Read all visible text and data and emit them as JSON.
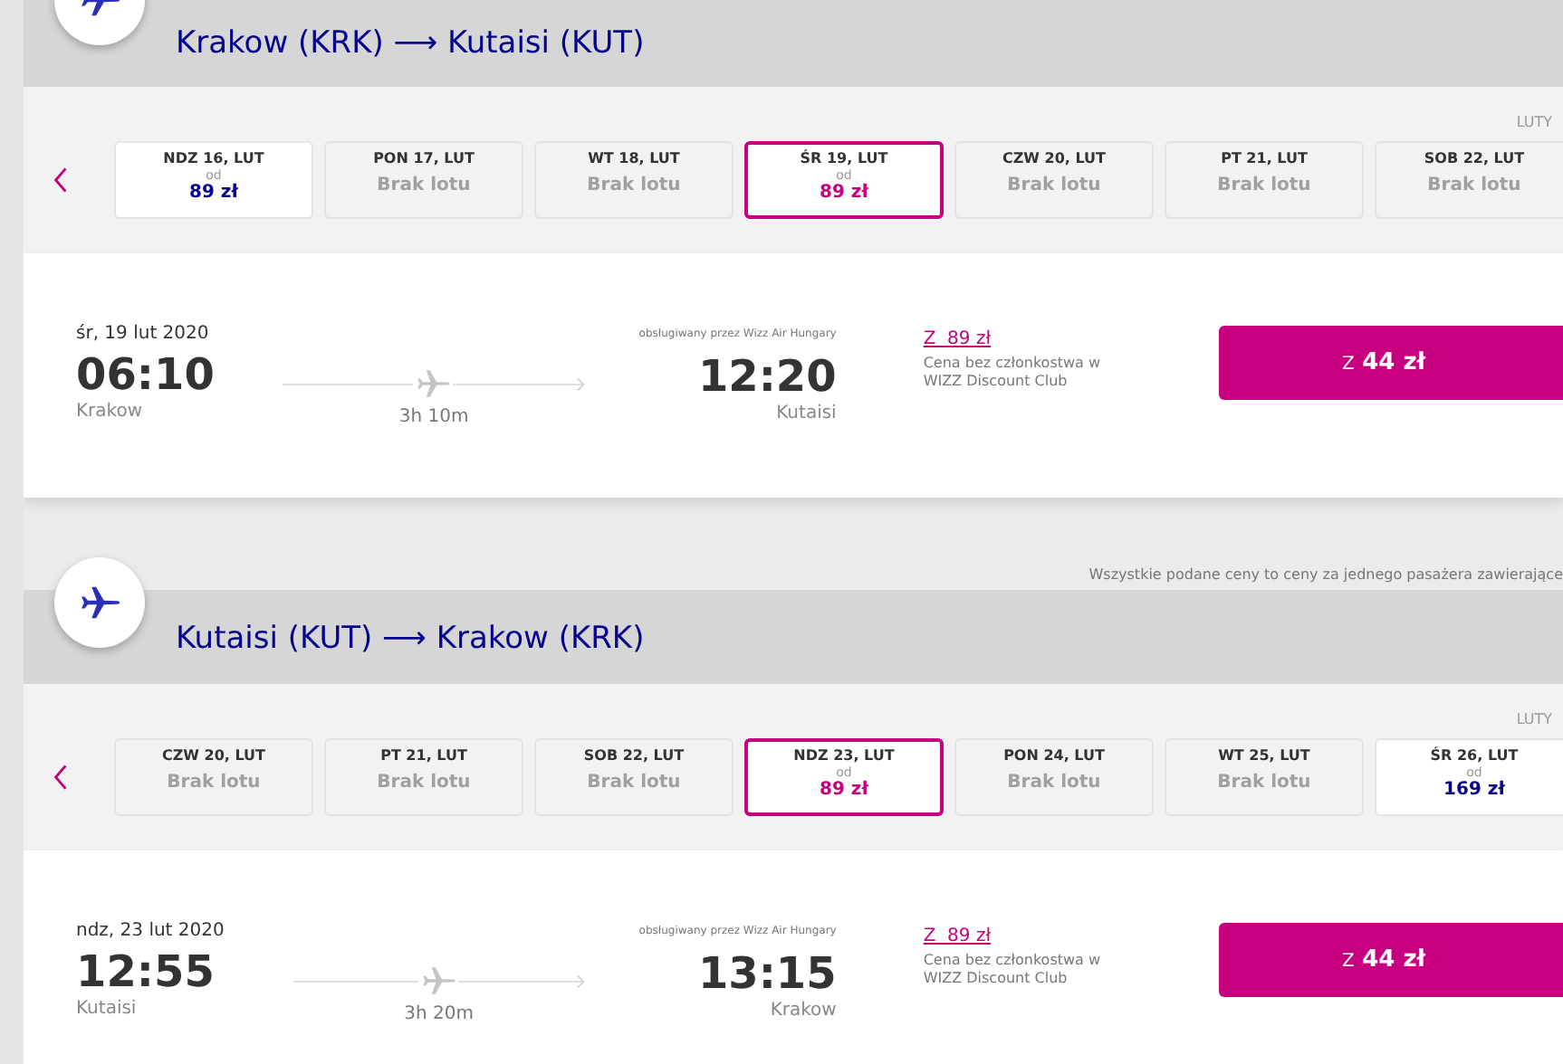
{
  "legs": [
    {
      "route": "Krakow (KRK) ⟶ Kutaisi (KUT)",
      "month": "LUTY",
      "days": [
        {
          "label": "NDZ 16, LUT",
          "kind": "fare",
          "from": "od",
          "price": "89 zł",
          "selected": false
        },
        {
          "label": "PON 17, LUT",
          "kind": "none",
          "text": "Brak lotu",
          "selected": false
        },
        {
          "label": "WT 18, LUT",
          "kind": "none",
          "text": "Brak lotu",
          "selected": false
        },
        {
          "label": "ŚR 19, LUT",
          "kind": "fare",
          "from": "od",
          "price": "89 zł",
          "selected": true
        },
        {
          "label": "CZW 20, LUT",
          "kind": "none",
          "text": "Brak lotu",
          "selected": false
        },
        {
          "label": "PT 21, LUT",
          "kind": "none",
          "text": "Brak lotu",
          "selected": false
        },
        {
          "label": "SOB 22, LUT",
          "kind": "none",
          "text": "Brak lotu",
          "selected": false
        }
      ],
      "flight": {
        "date": "śr, 19 lut 2020",
        "operator": "obsługiwany przez Wizz Air Hungary",
        "departure_time": "06:10",
        "departure_city": "Krakow",
        "duration": "3h 10m",
        "arrival_time": "12:20",
        "arrival_city": "Kutaisi",
        "member_prefix": "Z",
        "member_price": "89 zł",
        "member_note": "Cena bez członkostwa w WIZZ Discount Club",
        "button_prefix": "Z",
        "button_price": "44 zł"
      }
    },
    {
      "route": "Kutaisi (KUT) ⟶ Krakow (KRK)",
      "month": "LUTY",
      "days": [
        {
          "label": "CZW 20, LUT",
          "kind": "none",
          "text": "Brak lotu",
          "selected": false
        },
        {
          "label": "PT 21, LUT",
          "kind": "none",
          "text": "Brak lotu",
          "selected": false
        },
        {
          "label": "SOB 22, LUT",
          "kind": "none",
          "text": "Brak lotu",
          "selected": false
        },
        {
          "label": "NDZ 23, LUT",
          "kind": "fare",
          "from": "od",
          "price": "89 zł",
          "selected": true
        },
        {
          "label": "PON 24, LUT",
          "kind": "none",
          "text": "Brak lotu",
          "selected": false
        },
        {
          "label": "WT 25, LUT",
          "kind": "none",
          "text": "Brak lotu",
          "selected": false
        },
        {
          "label": "ŚR 26, LUT",
          "kind": "fare",
          "from": "od",
          "price": "169 zł",
          "selected": false
        }
      ],
      "flight": {
        "date": "ndz, 23 lut 2020",
        "operator": "obsługiwany przez Wizz Air Hungary",
        "departure_time": "12:55",
        "departure_city": "Kutaisi",
        "duration": "3h 20m",
        "arrival_time": "13:15",
        "arrival_city": "Krakow",
        "member_prefix": "Z",
        "member_price": "89 zł",
        "member_note": "Cena bez członkostwa w WIZZ Discount Club",
        "button_prefix": "Z",
        "button_price": "44 zł"
      }
    }
  ],
  "price_note": "Wszystkie podane ceny to ceny za jednego pasażera zawierające"
}
